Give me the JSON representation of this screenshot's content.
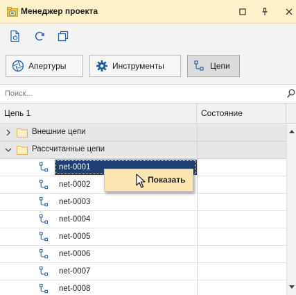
{
  "panel": {
    "title": "Менеджер проекта",
    "colors": {
      "title_bg": "#fdf1c9",
      "selection": "#1f3f73",
      "menu_bg": "#fbe6b1"
    }
  },
  "window_controls": {
    "maximize_icon": "restore-icon",
    "pin_icon": "pin-icon",
    "close_icon": "close-icon"
  },
  "toolbar": {
    "icons": [
      "document-gear-icon",
      "refresh-icon",
      "copy-icon"
    ]
  },
  "tabs": [
    {
      "label": "Апертуры",
      "icon": "aperture-icon",
      "active": false
    },
    {
      "label": "Инструменты",
      "icon": "gear-icon",
      "active": false
    },
    {
      "label": "Цепи",
      "icon": "net-icon",
      "active": true
    }
  ],
  "search": {
    "placeholder": "Поиск..."
  },
  "grid": {
    "columns": [
      "Цепь 1",
      "Состояние"
    ],
    "groups": [
      {
        "label": "Внешние цепи",
        "expanded": false
      },
      {
        "label": "Рассчитанные цепи",
        "expanded": true
      }
    ],
    "nets": [
      "net-0001",
      "net-0002",
      "net-0003",
      "net-0004",
      "net-0005",
      "net-0006",
      "net-0007",
      "net-0008"
    ],
    "selected": "net-0001"
  },
  "context_menu": {
    "show_label": "Показать"
  }
}
